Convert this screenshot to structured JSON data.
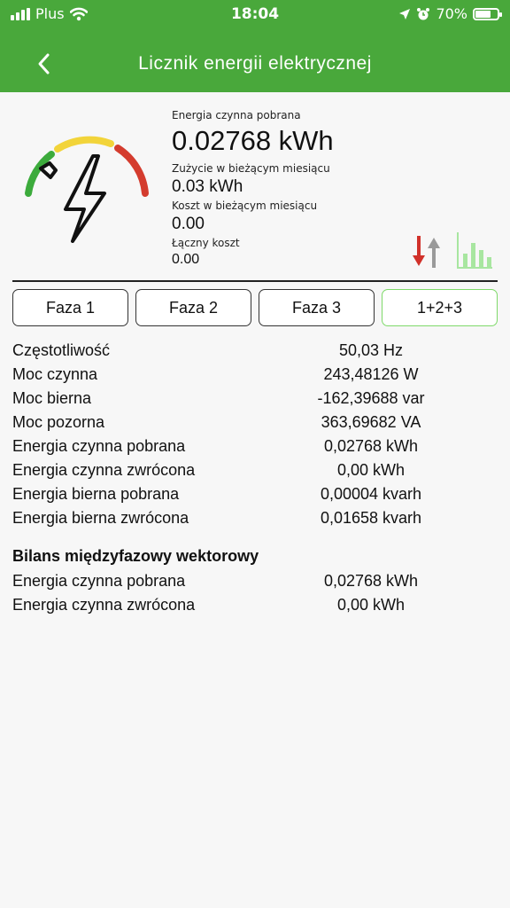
{
  "status_bar": {
    "carrier": "Plus",
    "time": "18:04",
    "battery": "70%",
    "battery_level": 0.7
  },
  "header": {
    "title": "Licznik energii elektrycznej",
    "back_icon": "chevron-left-icon"
  },
  "summary": {
    "active_energy_label": "Energia czynna pobrana",
    "active_energy_value": "0.02768 kWh",
    "month_usage_label": "Zużycie w bieżącym miesiącu",
    "month_usage_value": "0.03 kWh",
    "month_cost_label": "Koszt w bieżącym miesiącu",
    "month_cost_value": "0.00",
    "total_cost_label": "Łączny koszt",
    "total_cost_value": "0.00"
  },
  "colors": {
    "brand": "#49a83b",
    "gauge_green": "#3cab3c",
    "gauge_yellow": "#f2d43a",
    "gauge_red": "#d43c2e",
    "arrow_down": "#d1312a",
    "arrow_up": "#9a9a9a",
    "tab_active_border": "#7fd96a",
    "chart_icon": "#a8e6a0"
  },
  "tabs": [
    {
      "label": "Faza 1",
      "active": false
    },
    {
      "label": "Faza 2",
      "active": false
    },
    {
      "label": "Faza 3",
      "active": false
    },
    {
      "label": "1+2+3",
      "active": true
    }
  ],
  "params": [
    {
      "label": "Częstotliwość",
      "value": "50,03 Hz"
    },
    {
      "label": "Moc czynna",
      "value": "243,48126 W"
    },
    {
      "label": "Moc bierna",
      "value": "-162,39688 var"
    },
    {
      "label": "Moc pozorna",
      "value": "363,69682 VA"
    },
    {
      "label": "Energia czynna pobrana",
      "value": "0,02768 kWh"
    },
    {
      "label": "Energia czynna zwrócona",
      "value": "0,00 kWh"
    },
    {
      "label": "Energia bierna pobrana",
      "value": "0,00004 kvarh"
    },
    {
      "label": "Energia bierna zwrócona",
      "value": "0,01658 kvarh"
    }
  ],
  "balance": {
    "title": "Bilans międzyfazowy wektorowy",
    "rows": [
      {
        "label": "Energia czynna pobrana",
        "value": "0,02768 kWh"
      },
      {
        "label": "Energia czynna zwrócona",
        "value": "0,00 kWh"
      }
    ]
  }
}
